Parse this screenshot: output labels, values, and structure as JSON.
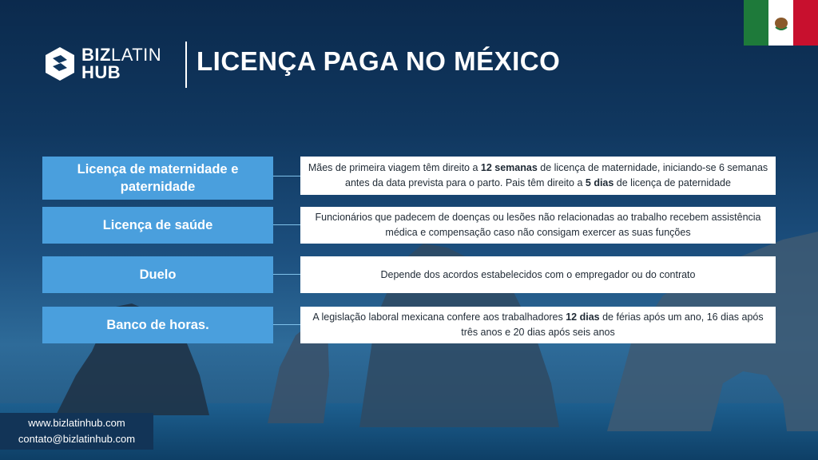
{
  "colors": {
    "accent": "#4a9fdd",
    "background": "#10375f",
    "text_box": "#ffffff",
    "contact_bg": "#123457"
  },
  "brand": {
    "line1_a": "BIZ",
    "line1_b": "LATIN",
    "line2": "HUB"
  },
  "title": "LICENÇA PAGA NO MÉXICO",
  "flag": {
    "icon": "mexico-flag-icon"
  },
  "rows": [
    {
      "label": "Licença de maternidade e paternidade",
      "desc_parts": [
        "Mães de primeira viagem têm direito a ",
        "12 semanas",
        " de licença de maternidade, iniciando-se 6 semanas antes da data prevista para o parto. Pais têm direito a ",
        "5 dias",
        " de licença de paternidade"
      ]
    },
    {
      "label": "Licença de saúde",
      "desc_parts": [
        "Funcionários que padecem de doenças ou lesões não relacionadas ao trabalho recebem assistência médica e compensação caso não consigam exercer as suas funções"
      ]
    },
    {
      "label": "Duelo",
      "desc_parts": [
        "Depende dos acordos estabelecidos com o empregador ou do contrato"
      ]
    },
    {
      "label": "Banco de horas.",
      "desc_parts": [
        "A legislação laboral mexicana confere aos trabalhadores ",
        "12 dias",
        " de férias após um ano, 16 dias após três anos e 20 dias após seis anos"
      ]
    }
  ],
  "contact": {
    "website": "www.bizlatinhub.com",
    "email": "contato@bizlatinhub.com"
  }
}
